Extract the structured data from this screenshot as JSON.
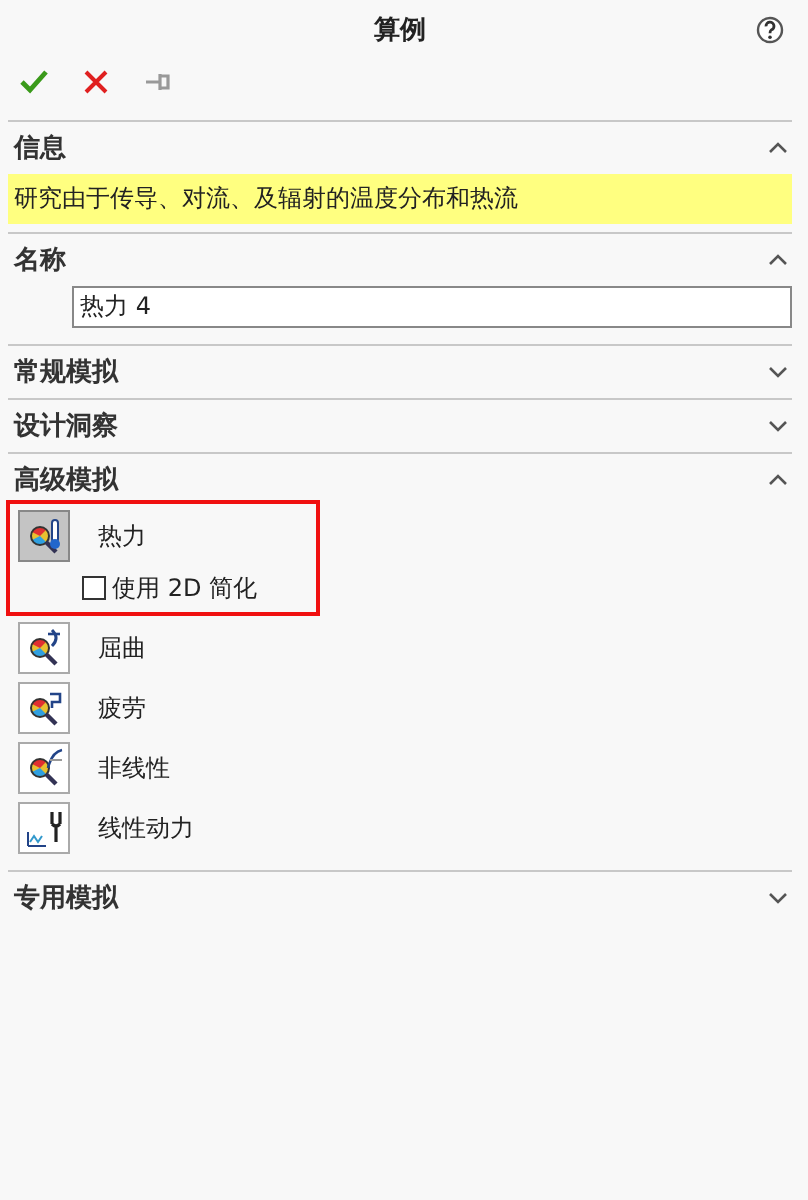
{
  "panel": {
    "title": "算例"
  },
  "toolbar": [
    {
      "kind": "ok"
    },
    {
      "kind": "cancel"
    },
    {
      "kind": "pin"
    }
  ],
  "sections": [
    {
      "title": "信息",
      "expanded": true,
      "kind": "info",
      "text": "研究由于传导、对流、及辐射的温度分布和热流"
    },
    {
      "title": "名称",
      "expanded": true,
      "kind": "name",
      "value": "热力 4"
    },
    {
      "title": "常规模拟",
      "expanded": false
    },
    {
      "title": "设计洞察",
      "expanded": false
    },
    {
      "title": "高级模拟",
      "expanded": true,
      "kind": "studies",
      "items": [
        {
          "label": "热力",
          "selected": true,
          "highlighted": true,
          "kind": "thermal",
          "option": {
            "label": "使用 2D 简化",
            "checked": false
          }
        },
        {
          "label": "屈曲",
          "selected": false,
          "highlighted": false,
          "kind": "buckling"
        },
        {
          "label": "疲劳",
          "selected": false,
          "highlighted": false,
          "kind": "fatigue"
        },
        {
          "label": "非线性",
          "selected": false,
          "highlighted": false,
          "kind": "nonlinear"
        },
        {
          "label": "线性动力",
          "selected": false,
          "highlighted": false,
          "kind": "dynamic"
        }
      ]
    },
    {
      "title": "专用模拟",
      "expanded": false
    }
  ]
}
